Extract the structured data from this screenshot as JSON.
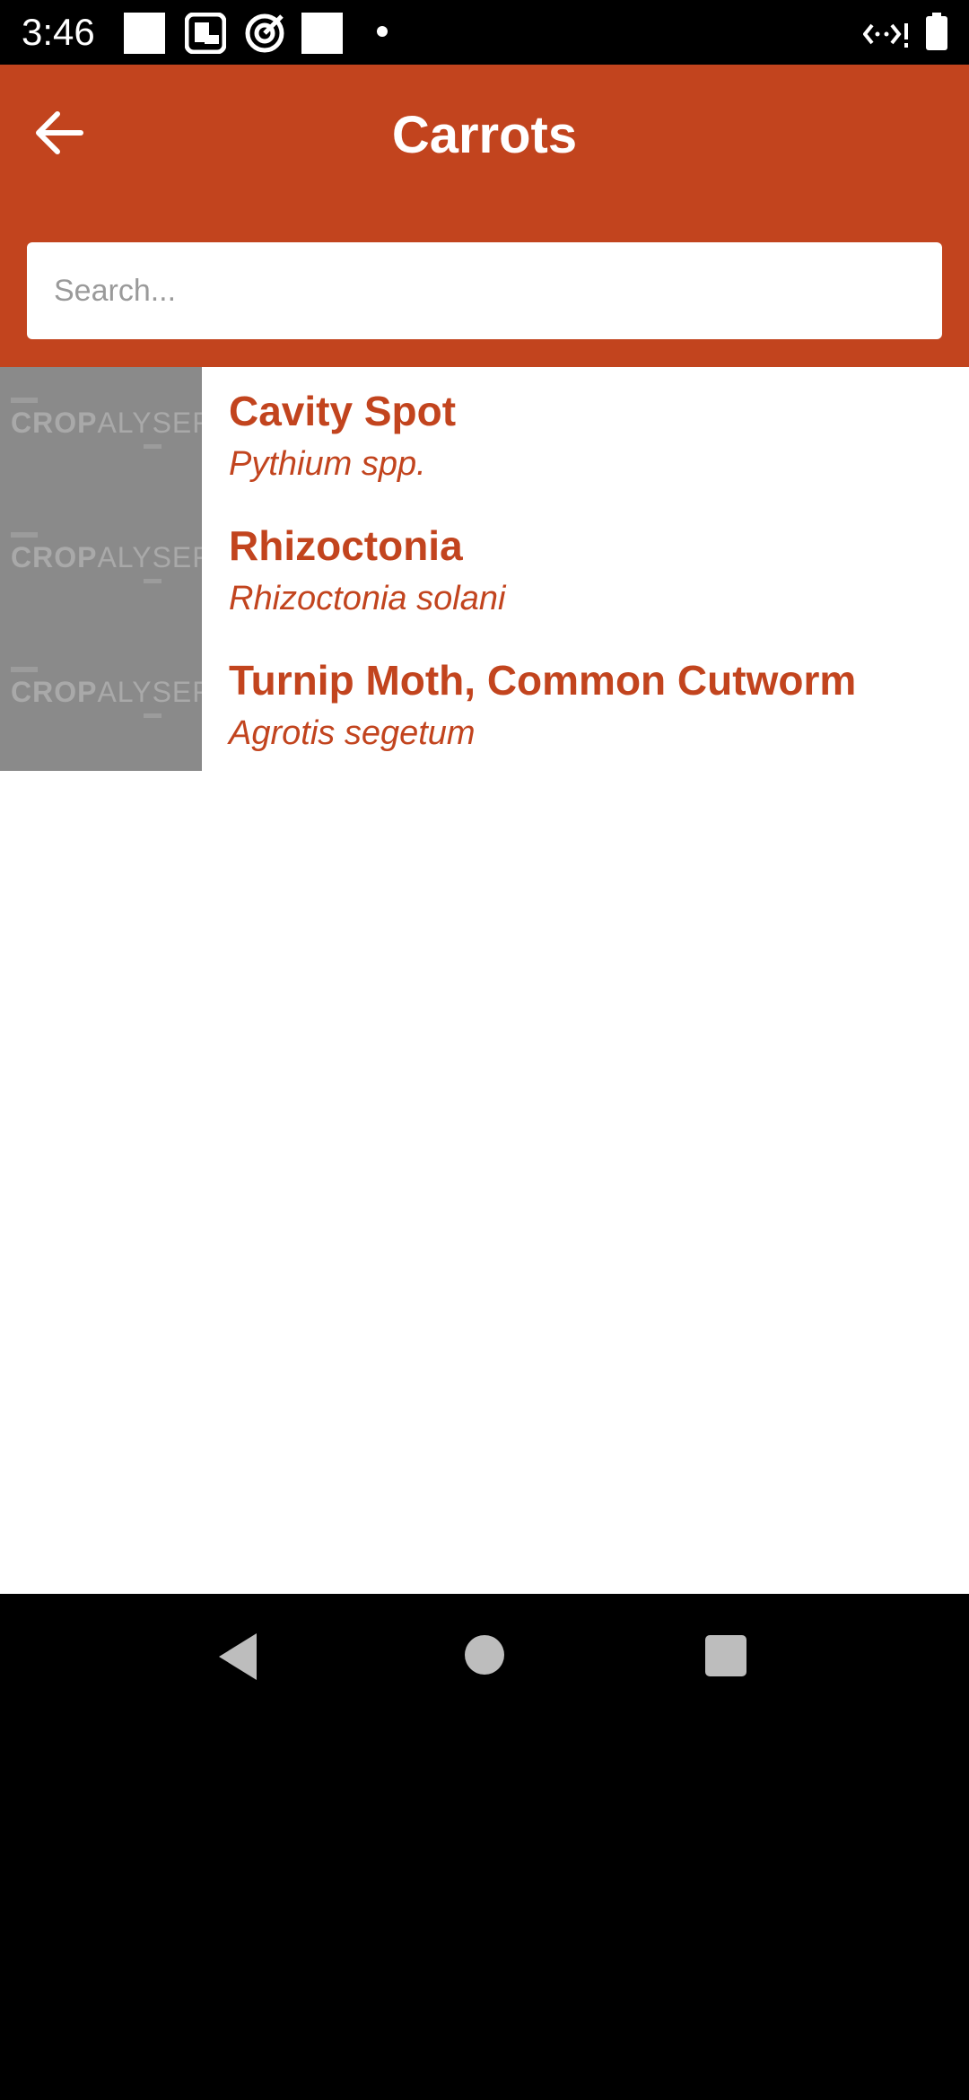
{
  "status_bar": {
    "time": "3:46",
    "icons": [
      "notification-square-icon",
      "news-app-icon",
      "target-app-icon",
      "notification-square-icon",
      "dot-icon",
      "signal-icon",
      "battery-icon"
    ]
  },
  "app_bar": {
    "title": "Carrots",
    "back_icon": "arrow-left-icon"
  },
  "search": {
    "placeholder": "Search...",
    "value": ""
  },
  "list": {
    "items": [
      {
        "title": "Cavity Spot",
        "subtitle": "Pythium spp.",
        "thumb_text_a": "CROP",
        "thumb_text_b": "ALYSER"
      },
      {
        "title": "Rhizoctonia",
        "subtitle": "Rhizoctonia solani",
        "thumb_text_a": "CROP",
        "thumb_text_b": "ALYSER"
      },
      {
        "title": "Turnip Moth, Common Cutworm",
        "subtitle": "Agrotis segetum",
        "thumb_text_a": "CROP",
        "thumb_text_b": "ALYSER"
      }
    ]
  },
  "nav_bar": {
    "back": "nav-back-icon",
    "home": "nav-home-icon",
    "recents": "nav-recents-icon"
  },
  "colors": {
    "accent": "#C2441E",
    "thumb_bg": "#8A8A8A"
  }
}
